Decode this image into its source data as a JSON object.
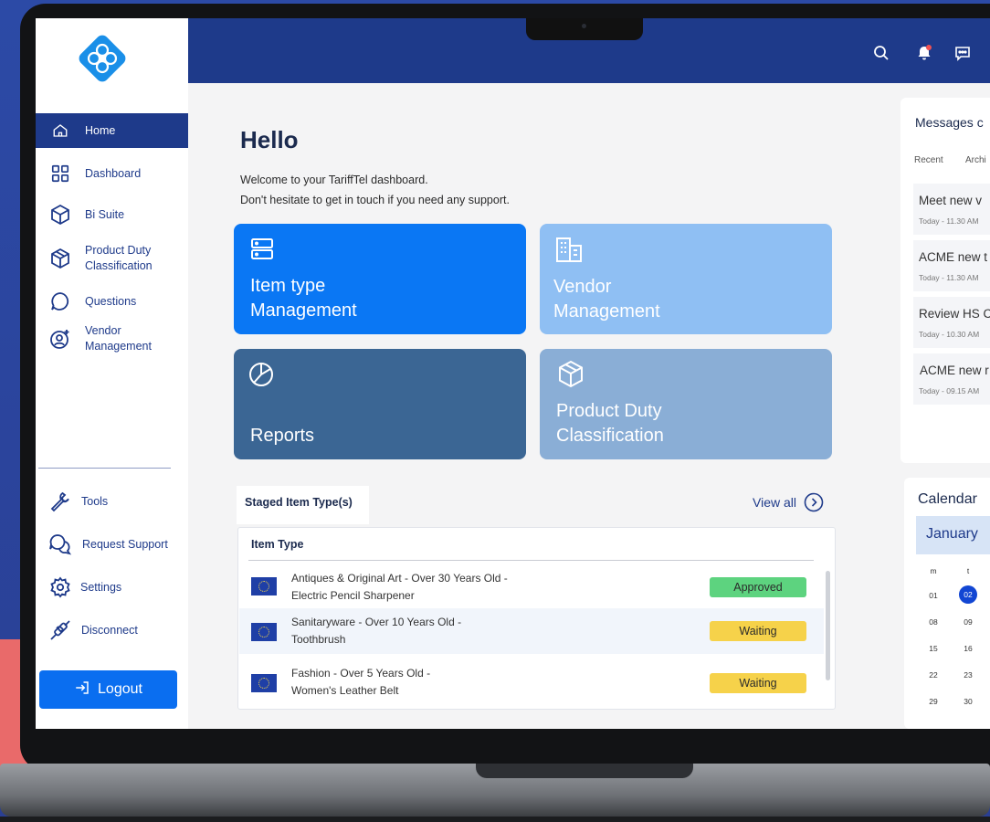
{
  "sidebar": {
    "items": [
      {
        "label": "Home",
        "icon": "home-icon"
      },
      {
        "label": "Dashboard",
        "icon": "grid-icon"
      },
      {
        "label": "Bi Suite",
        "icon": "cube-icon"
      },
      {
        "label": "Product Duty Classification",
        "icon": "box-icon"
      },
      {
        "label": "Questions",
        "icon": "chat-bubble-icon"
      },
      {
        "label": "Vendor Management",
        "icon": "user-add-icon"
      }
    ],
    "tools": [
      {
        "label": "Tools",
        "icon": "wrench-icon"
      },
      {
        "label": "Request Support",
        "icon": "support-chat-icon"
      },
      {
        "label": "Settings",
        "icon": "gear-icon"
      },
      {
        "label": "Disconnect",
        "icon": "plug-icon"
      }
    ],
    "logout_label": "Logout"
  },
  "main": {
    "greeting": "Hello",
    "welcome_line1": "Welcome to your TariffTel dashboard.",
    "welcome_line2": "Don't hesitate to get in touch if you need any support.",
    "tiles": [
      {
        "line1": "Item type",
        "line2": "Management",
        "color": "#0a77f4"
      },
      {
        "line1": "Vendor",
        "line2": "Management",
        "color": "#8fbff3"
      },
      {
        "line1": "",
        "line2": "Reports",
        "color": "#3b6694"
      },
      {
        "line1": "Product Duty",
        "line2": "Classification",
        "color": "#8aaed6"
      }
    ],
    "staged": {
      "tab_label": "Staged Item Type(s)",
      "view_all": "View all",
      "column_header": "Item Type",
      "rows": [
        {
          "line1": "Antiques & Original Art - Over 30 Years Old -",
          "line2": "Electric Pencil Sharpener",
          "status": "Approved"
        },
        {
          "line1": "Sanitaryware - Over 10 Years Old -",
          "line2": "Toothbrush",
          "status": "Waiting"
        },
        {
          "line1": "Fashion - Over 5 Years Old -",
          "line2": "Women's Leather Belt",
          "status": "Waiting"
        }
      ]
    }
  },
  "messages": {
    "title": "Messages c",
    "tabs": [
      "Recent",
      "Archi"
    ],
    "items": [
      {
        "title": "Meet new v",
        "time": "Today - 11.30 AM"
      },
      {
        "title": "ACME new t",
        "time": "Today - 11.30 AM"
      },
      {
        "title": "Review HS C",
        "time": "Today - 10.30 AM"
      },
      {
        "title": "ACME new r",
        "time": "Today - 09.15 AM"
      }
    ]
  },
  "calendar": {
    "title": "Calendar",
    "month": "January",
    "day_headers": [
      "m",
      "t"
    ],
    "weeks": [
      [
        "01",
        "02"
      ],
      [
        "08",
        "09"
      ],
      [
        "15",
        "16"
      ],
      [
        "22",
        "23"
      ],
      [
        "29",
        "30"
      ]
    ],
    "selected": "02"
  },
  "colors": {
    "brand": "#1e3a8a",
    "accent": "#0a6ef0",
    "approved": "#5dd37f",
    "waiting": "#f6d24a"
  }
}
